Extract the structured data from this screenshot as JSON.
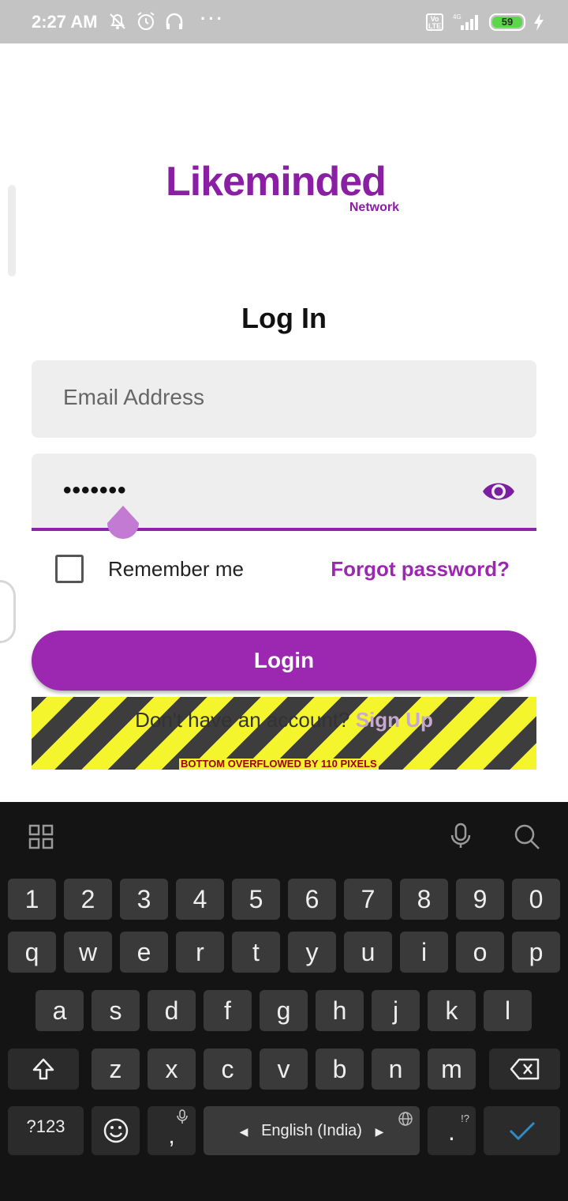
{
  "status_bar": {
    "time": "2:27 AM",
    "battery": "59",
    "network": "4G",
    "volte": "Vo LTE"
  },
  "logo": {
    "main": "Likeminded",
    "sub": "Network"
  },
  "title": "Log In",
  "email": {
    "placeholder": "Email Address"
  },
  "password": {
    "value": "•••••••"
  },
  "remember": {
    "label": "Remember me"
  },
  "forgot": {
    "label": "Forgot password?"
  },
  "login_button": {
    "label": "Login"
  },
  "signup": {
    "prompt": "Don't have an account?",
    "link": "Sign Up"
  },
  "overflow_message": "BOTTOM OVERFLOWED BY 110 PIXELS",
  "keyboard": {
    "numbers": [
      "1",
      "2",
      "3",
      "4",
      "5",
      "6",
      "7",
      "8",
      "9",
      "0"
    ],
    "row1": [
      "q",
      "w",
      "e",
      "r",
      "t",
      "y",
      "u",
      "i",
      "o",
      "p"
    ],
    "row2": [
      "a",
      "s",
      "d",
      "f",
      "g",
      "h",
      "j",
      "k",
      "l"
    ],
    "row3": [
      "z",
      "x",
      "c",
      "v",
      "b",
      "n",
      "m"
    ],
    "symbols_key": "?123",
    "comma": ",",
    "space_label": "English (India)",
    "period": ".",
    "period_hint": "!?"
  },
  "colors": {
    "accent": "#9c27b0",
    "status_bar": "#c3c3c3",
    "keyboard_bg": "#141414"
  }
}
